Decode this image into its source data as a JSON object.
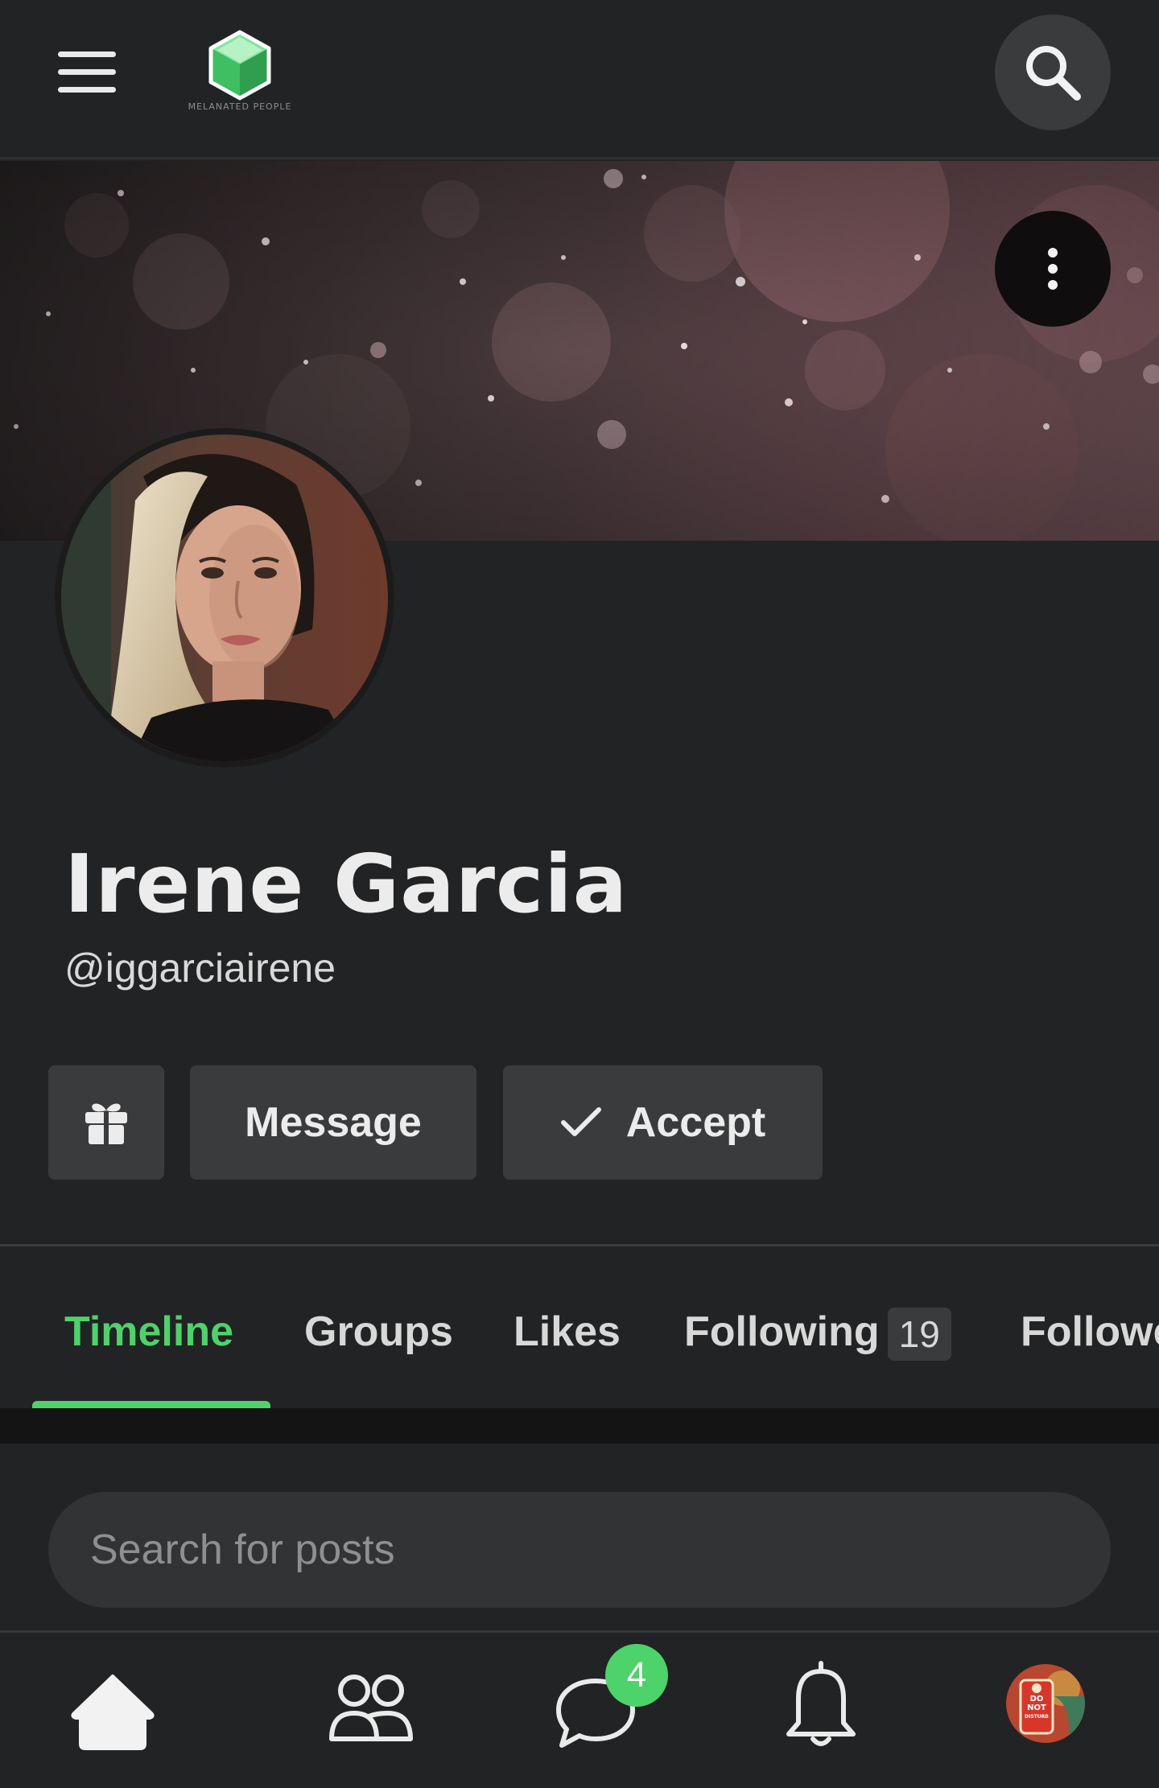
{
  "header": {
    "menu_icon": "hamburger-menu-icon",
    "logo_text": "MELANATED PEOPLE",
    "search_icon": "search-icon"
  },
  "cover": {
    "more_icon": "vertical-dots-icon"
  },
  "profile": {
    "name": "Irene Garcia",
    "handle": "@iggarciairene"
  },
  "actions": {
    "gift_icon": "gift-icon",
    "message_label": "Message",
    "accept_label": "Accept",
    "accept_icon": "checkmark-icon"
  },
  "tabs": [
    {
      "label": "Timeline",
      "active": true
    },
    {
      "label": "Groups"
    },
    {
      "label": "Likes"
    },
    {
      "label": "Following",
      "count": "19"
    },
    {
      "label": "Followers"
    }
  ],
  "search": {
    "placeholder": "Search for posts"
  },
  "bottom_nav": {
    "items": [
      "home-icon",
      "people-icon",
      "chat-icon",
      "bell-icon",
      "profile-avatar"
    ],
    "chat_badge": "4"
  },
  "profile_thumb": {
    "sign_line1": "DO",
    "sign_line2": "NOT",
    "sign_line3": "DISTURB"
  },
  "colors": {
    "accent": "#4cd36a",
    "background": "#222324",
    "button": "#3a3b3d"
  }
}
